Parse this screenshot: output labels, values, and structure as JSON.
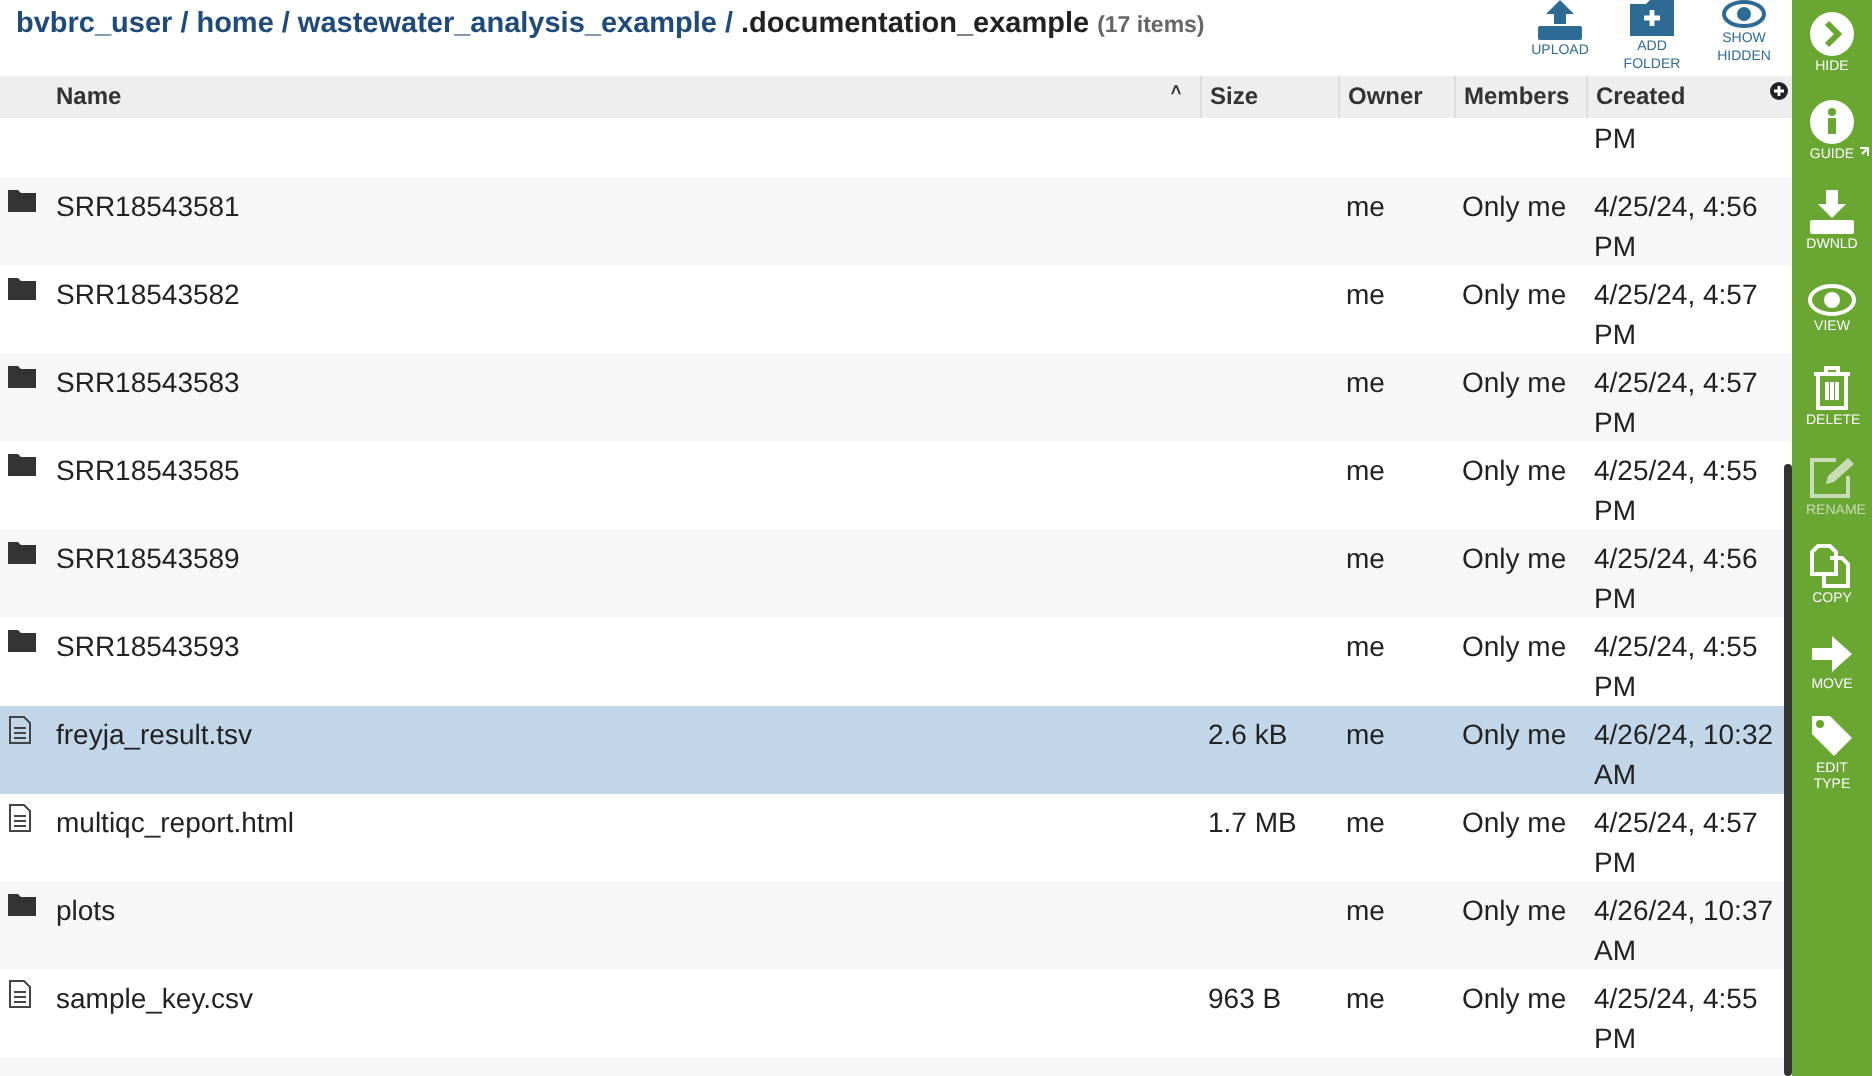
{
  "breadcrumb": {
    "links": [
      "bvbrc_user",
      "home",
      "wastewater_analysis_example"
    ],
    "separator": "/",
    "current": ".documentation_example",
    "count": "(17 items)"
  },
  "toolbar": [
    {
      "kind": "upload",
      "label": "UPLOAD"
    },
    {
      "kind": "add-folder",
      "label": "ADD FOLDER"
    },
    {
      "kind": "show-hidden",
      "label": "SHOW HIDDEN"
    }
  ],
  "table": {
    "columns": [
      "Name",
      "Size",
      "Owner",
      "Members",
      "Created"
    ],
    "sort_mark": "˄",
    "partial_top": {
      "created": "PM"
    },
    "rows": [
      {
        "kind": "folder",
        "name": "SRR18543581",
        "size": "",
        "owner": "me",
        "members": "Only me",
        "created": "4/25/24, 4:56 PM",
        "selected": false
      },
      {
        "kind": "folder",
        "name": "SRR18543582",
        "size": "",
        "owner": "me",
        "members": "Only me",
        "created": "4/25/24, 4:57 PM",
        "selected": false
      },
      {
        "kind": "folder",
        "name": "SRR18543583",
        "size": "",
        "owner": "me",
        "members": "Only me",
        "created": "4/25/24, 4:57 PM",
        "selected": false
      },
      {
        "kind": "folder",
        "name": "SRR18543585",
        "size": "",
        "owner": "me",
        "members": "Only me",
        "created": "4/25/24, 4:55 PM",
        "selected": false
      },
      {
        "kind": "folder",
        "name": "SRR18543589",
        "size": "",
        "owner": "me",
        "members": "Only me",
        "created": "4/25/24, 4:56 PM",
        "selected": false
      },
      {
        "kind": "folder",
        "name": "SRR18543593",
        "size": "",
        "owner": "me",
        "members": "Only me",
        "created": "4/25/24, 4:55 PM",
        "selected": false
      },
      {
        "kind": "file",
        "name": "freyja_result.tsv",
        "size": "2.6 kB",
        "owner": "me",
        "members": "Only me",
        "created": "4/26/24, 10:32 AM",
        "selected": true
      },
      {
        "kind": "file",
        "name": "multiqc_report.html",
        "size": "1.7 MB",
        "owner": "me",
        "members": "Only me",
        "created": "4/25/24, 4:57 PM",
        "selected": false
      },
      {
        "kind": "folder",
        "name": "plots",
        "size": "",
        "owner": "me",
        "members": "Only me",
        "created": "4/26/24, 10:37 AM",
        "selected": false
      },
      {
        "kind": "file",
        "name": "sample_key.csv",
        "size": "963 B",
        "owner": "me",
        "members": "Only me",
        "created": "4/25/24, 4:55 PM",
        "selected": false
      }
    ]
  },
  "sidebar": [
    {
      "kind": "hide",
      "label": "HIDE",
      "disabled": false
    },
    {
      "kind": "guide",
      "label": "GUIDE",
      "disabled": false
    },
    {
      "kind": "download",
      "label": "DWNLD",
      "disabled": false
    },
    {
      "kind": "view",
      "label": "VIEW",
      "disabled": false
    },
    {
      "kind": "delete",
      "label": "DELETE",
      "disabled": false
    },
    {
      "kind": "rename",
      "label": "RENAME",
      "disabled": true
    },
    {
      "kind": "copy",
      "label": "COPY",
      "disabled": false
    },
    {
      "kind": "move",
      "label": "MOVE",
      "disabled": false
    },
    {
      "kind": "edit-type",
      "label": "EDIT TYPE",
      "disabled": false
    }
  ]
}
